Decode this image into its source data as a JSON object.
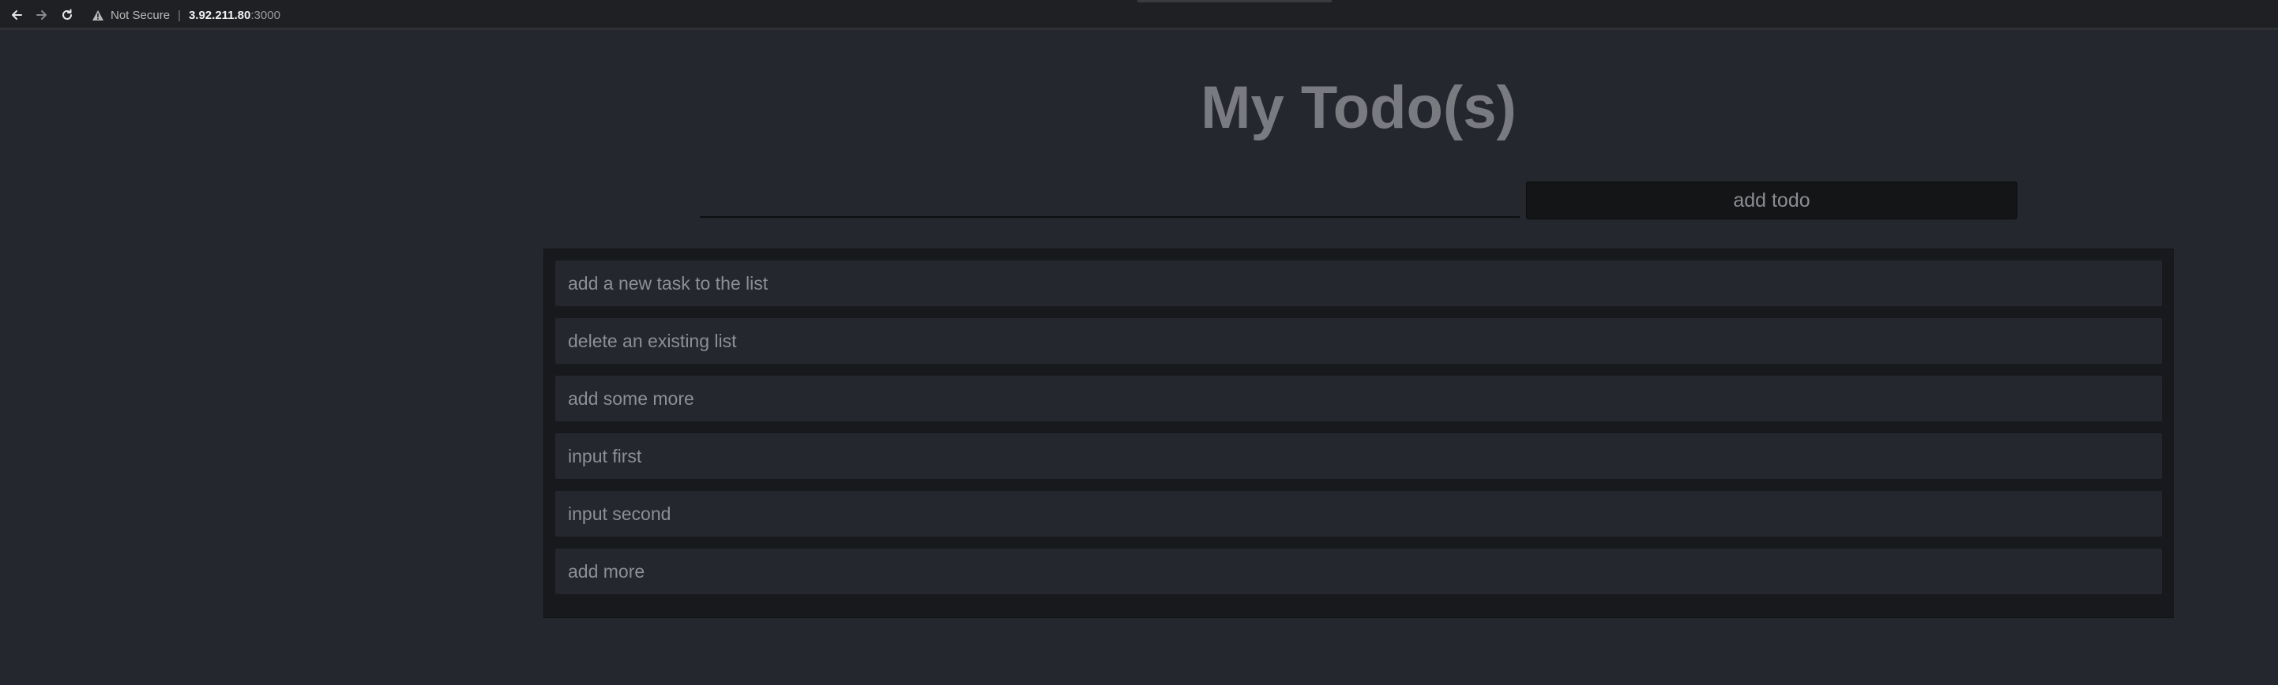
{
  "browser": {
    "security_label": "Not Secure",
    "separator": "|",
    "url_host": "3.92.211.80",
    "url_port": ":3000"
  },
  "app": {
    "title": "My Todo(s)",
    "input": {
      "value": "",
      "placeholder": ""
    },
    "add_button_label": "add todo",
    "todos": [
      "add a new task to the list",
      "delete an existing list",
      "add some more",
      "input first",
      "input second",
      "add more"
    ]
  },
  "colors": {
    "page_background": "#25272e",
    "panel_background": "#18191c",
    "title_text": "#7a7b80",
    "item_text": "#8e8f94"
  }
}
